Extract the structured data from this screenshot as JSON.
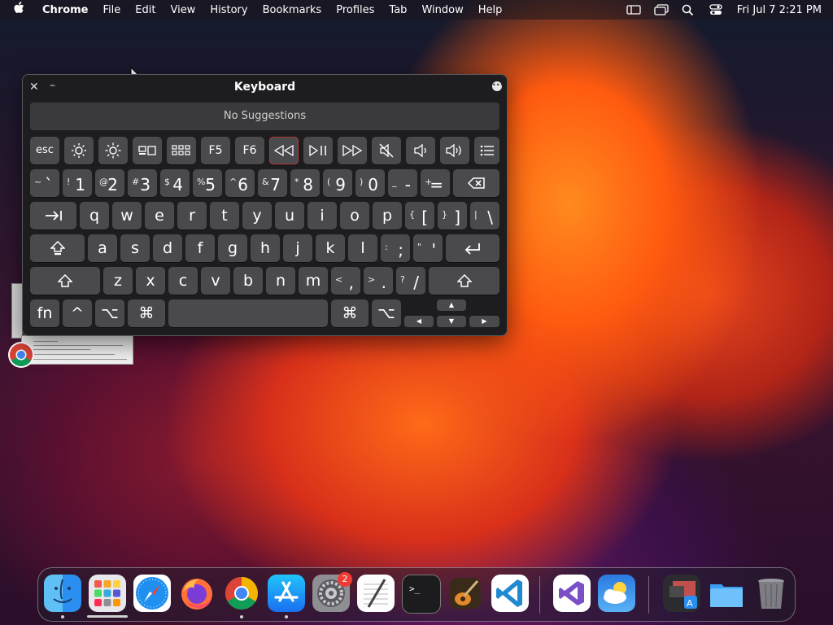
{
  "menubar": {
    "app": "Chrome",
    "items": [
      "File",
      "Edit",
      "View",
      "History",
      "Bookmarks",
      "Profiles",
      "Tab",
      "Window",
      "Help"
    ],
    "datetime": "Fri Jul 7  2:21 PM"
  },
  "keyboard": {
    "title": "Keyboard",
    "suggestions": "No Suggestions",
    "fn_row": [
      "esc",
      "brightness-down-icon",
      "brightness-up-icon",
      "mission-control-icon",
      "launchpad-icon",
      "F5",
      "F6",
      "rewind-icon",
      "play-pause-icon",
      "fast-forward-icon",
      "mute-icon",
      "volume-down-icon",
      "volume-up-icon",
      "menu-icon"
    ],
    "f5": "F5",
    "f6": "F6",
    "esc": "esc",
    "number_row": [
      {
        "sec": "~",
        "pri": "`"
      },
      {
        "sec": "!",
        "pri": "1"
      },
      {
        "sec": "@",
        "pri": "2"
      },
      {
        "sec": "#",
        "pri": "3"
      },
      {
        "sec": "$",
        "pri": "4"
      },
      {
        "sec": "%",
        "pri": "5"
      },
      {
        "sec": "^",
        "pri": "6"
      },
      {
        "sec": "&",
        "pri": "7"
      },
      {
        "sec": "*",
        "pri": "8"
      },
      {
        "sec": "(",
        "pri": "9"
      },
      {
        "sec": ")",
        "pri": "0"
      },
      {
        "sec": "_",
        "pri": "-"
      },
      {
        "sec": "+",
        "pri": "="
      }
    ],
    "qwerty_row": [
      "q",
      "w",
      "e",
      "r",
      "t",
      "y",
      "u",
      "i",
      "o",
      "p"
    ],
    "qwerty_extra": [
      {
        "sec": "{",
        "pri": "["
      },
      {
        "sec": "}",
        "pri": "]"
      },
      {
        "sec": "|",
        "pri": "\\"
      }
    ],
    "asdf_row": [
      "a",
      "s",
      "d",
      "f",
      "g",
      "h",
      "j",
      "k",
      "l"
    ],
    "asdf_extra": [
      {
        "sec": ":",
        "pri": ";"
      },
      {
        "sec": "\"",
        "pri": "'"
      }
    ],
    "zxcv_row": [
      "z",
      "x",
      "c",
      "v",
      "b",
      "n",
      "m"
    ],
    "zxcv_extra": [
      {
        "sec": "<",
        "pri": ","
      },
      {
        "sec": ">",
        "pri": "."
      },
      {
        "sec": "?",
        "pri": "/"
      }
    ],
    "bottom": {
      "fn": "fn",
      "ctrl": "^",
      "opt": "⌥",
      "cmd": "⌘"
    }
  },
  "dock": {
    "apps": [
      "finder",
      "launchpad",
      "safari",
      "firefox",
      "chrome",
      "app-store",
      "system-settings",
      "textedit",
      "terminal",
      "garageband",
      "vscode",
      "visual-studio",
      "weather",
      "image-capture",
      "downloads-folder",
      "trash"
    ],
    "settings_badge": "2"
  }
}
